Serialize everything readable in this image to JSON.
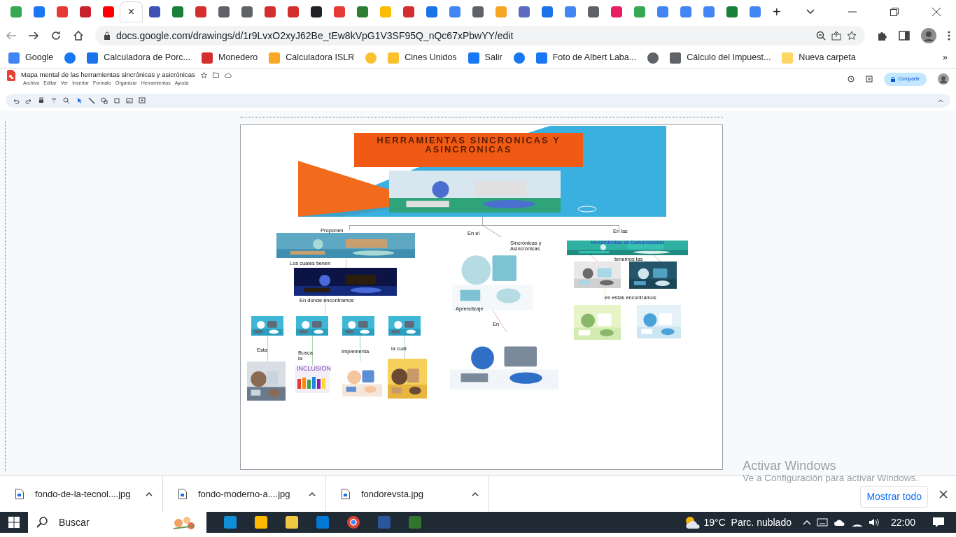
{
  "tabs": [
    {
      "color": "#34a853",
      "selected": false
    },
    {
      "color": "#1877f2",
      "selected": false
    },
    {
      "color": "#e53935",
      "selected": false
    },
    {
      "color": "#c8232c",
      "selected": false
    },
    {
      "color": "#ff0000",
      "selected": false
    },
    {
      "selected": true,
      "close": "×"
    },
    {
      "color": "#3f51b5",
      "selected": false
    },
    {
      "color": "#188038",
      "selected": false
    },
    {
      "color": "#d32f2f",
      "selected": false
    },
    {
      "color": "#5f6368",
      "selected": false
    },
    {
      "color": "#5f6368",
      "selected": false
    },
    {
      "color": "#d32f2f",
      "selected": false
    },
    {
      "color": "#d32f2f",
      "selected": false
    },
    {
      "color": "#202124",
      "selected": false
    },
    {
      "color": "#e53935",
      "selected": false
    },
    {
      "color": "#2e7d32",
      "selected": false
    },
    {
      "color": "#fbbc04",
      "selected": false
    },
    {
      "color": "#d32f2f",
      "selected": false
    },
    {
      "color": "#1a73e8",
      "selected": false
    },
    {
      "color": "#4285f4",
      "selected": false
    },
    {
      "color": "#5f6368",
      "selected": false
    },
    {
      "color": "#f5a623",
      "selected": false
    },
    {
      "color": "#5c6bc0",
      "selected": false
    },
    {
      "color": "#1a73e8",
      "selected": false
    },
    {
      "color": "#4285f4",
      "selected": false
    },
    {
      "color": "#5f6368",
      "selected": false
    },
    {
      "color": "#e91e63",
      "selected": false
    },
    {
      "color": "#34a853",
      "selected": false
    },
    {
      "color": "#4285f4",
      "selected": false
    },
    {
      "color": "#4285f4",
      "selected": false
    },
    {
      "color": "#4285f4",
      "selected": false
    },
    {
      "color": "#188038",
      "selected": false
    },
    {
      "color": "#4285f4",
      "selected": false
    }
  ],
  "new_tab": "+",
  "address": "docs.google.com/drawings/d/1r9LvxO2xyJ62Be_tEw8kVpG1V3SF95Q_nQc67xPbwYY/edit",
  "bookmarks": [
    {
      "label": "Google",
      "color": "#4285f4"
    },
    {
      "color": "#1877f2"
    },
    {
      "label": "Calculadora de Porc...",
      "color": "#1a73e8"
    },
    {
      "label": "Monedero",
      "color": "#d32f2f"
    },
    {
      "label": "Calculadora ISLR",
      "color": "#f9a825"
    },
    {
      "color": "#fbc02d"
    },
    {
      "label": "Cines Unidos",
      "color": "#fbc02d"
    },
    {
      "label": "Salir",
      "color": "#1877f2"
    },
    {
      "color": "#1877f2"
    },
    {
      "label": "Foto de Albert Laba...",
      "color": "#1877f2"
    },
    {
      "color": "#5f6368"
    },
    {
      "label": "Cálculo del Impuest...",
      "color": "#5f6368"
    },
    {
      "label": "Nueva carpeta",
      "color": "#fdd663"
    }
  ],
  "bookmarks_more": "»",
  "doc": {
    "title": "Mapa mental de las herramientas sincrónicas y asicrónicas",
    "menu": [
      "Archivo",
      "Editar",
      "Ver",
      "Insertar",
      "Formato",
      "Organizar",
      "Herramientas",
      "Ayuda"
    ],
    "share": "Compartir"
  },
  "map": {
    "title": "HERRAMIENTAS SINCRONICAS Y ASINCRONICAS",
    "labels": [
      "Proponen",
      "Los cuales tienen",
      "En donde encontramos",
      "Esta",
      "Busca la",
      "Implementa",
      "la cual",
      "En el",
      "Sincrónicas y Asincrónicas",
      "Aprendizaje",
      "En",
      "En las",
      "tenemos las",
      "en estas encontramos"
    ],
    "banner": "Herramientas de Comunicación",
    "inclusion": "INCLUSION"
  },
  "downloads": [
    {
      "name": "fondo-de-la-tecnol....jpg"
    },
    {
      "name": "fondo-moderno-a....jpg"
    },
    {
      "name": "fondorevsta.jpg"
    }
  ],
  "show_all": "Mostrar todo",
  "activation": {
    "title": "Activar Windows",
    "hint": "Ve a Configuración para activar Windows."
  },
  "taskbar": {
    "search": "Buscar",
    "weather": "19°C  Parc. nublado",
    "time": "22:00"
  }
}
